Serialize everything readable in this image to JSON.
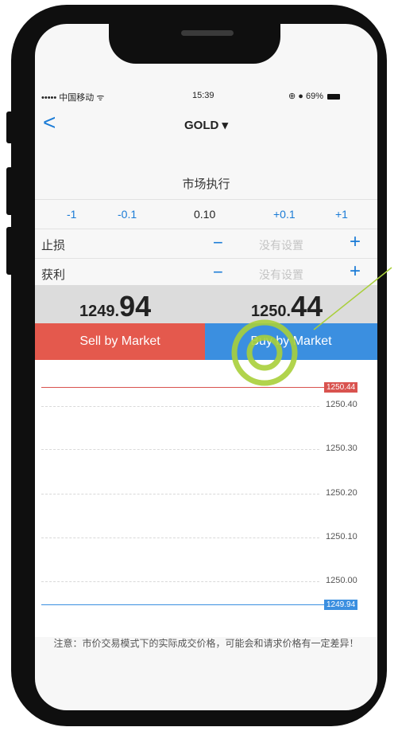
{
  "statusbar": {
    "carrier": "••••• 中国移动 ᯤ",
    "time": "15:39",
    "status_right": "⊕ ● 69%"
  },
  "nav": {
    "back": "<",
    "title": "GOLD ▾"
  },
  "order": {
    "execution_mode": "市场执行",
    "volume_steps": [
      "-1",
      "-0.1",
      "0.10",
      "+0.1",
      "+1"
    ],
    "stop_loss": {
      "label": "止损",
      "minus": "−",
      "placeholder": "没有设置",
      "plus": "+"
    },
    "take_profit": {
      "label": "获利",
      "minus": "−",
      "placeholder": "没有设置",
      "plus": "+"
    }
  },
  "prices": {
    "bid_prefix": "1249.",
    "bid_big": "94",
    "ask_prefix": "1250.",
    "ask_big": "44"
  },
  "buttons": {
    "sell": "Sell by Market",
    "buy": "Buy by Market"
  },
  "chart": {
    "ticks": [
      "1250.40",
      "1250.30",
      "1250.20",
      "1250.10",
      "1250.00"
    ],
    "ask_tag": "1250.44",
    "bid_tag": "1249.94"
  },
  "notice": "注意：市价交易模式下的实际成交价格，可能会和请求价格有一定差异！",
  "colors": {
    "sell": "#e4594d",
    "buy": "#3b8fe0",
    "accent": "#1a7bd6",
    "highlight": "#a9cf3a"
  }
}
